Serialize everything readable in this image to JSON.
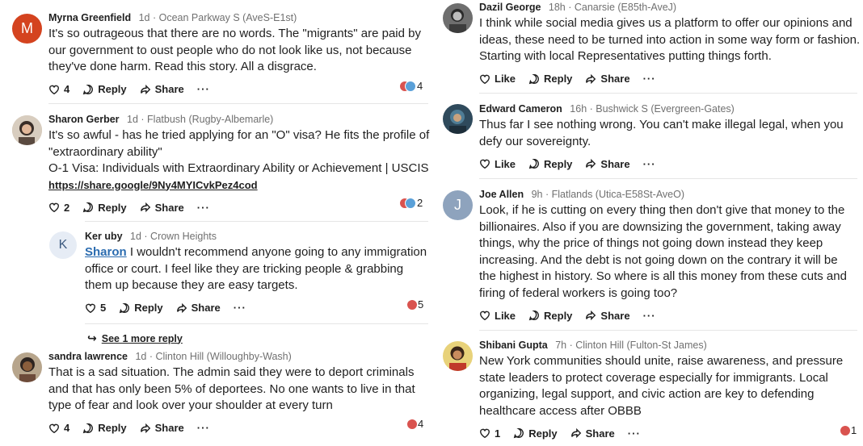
{
  "comments": [
    {
      "author": "Myrna Greenfield",
      "meta": "1d · Ocean Parkway S (AveS-E1st)",
      "avatar_letter": "M",
      "avatar_color": "#d4431f",
      "lines": [
        "It's so outrageous that there are no words. The \"migrants\" are paid by",
        "our government to oust people who do not look like us, not because",
        "they've done harm. Read this story. All a disgrace."
      ],
      "like_count": "4",
      "reply_label": "Reply",
      "share_label": "Share",
      "more": "···",
      "reaction_count": "4"
    },
    {
      "author": "Sharon Gerber",
      "meta": "1d · Flatbush (Rugby-Albemarle)",
      "lines": [
        "It's so awful - has he tried applying for an \"O\" visa?  He fits the profile of",
        "\"extraordinary ability\"",
        "O-1 Visa: Individuals with Extraordinary Ability or Achievement | USCIS"
      ],
      "link": "https://share.google/9Ny4MYICvkPez4cod",
      "like_count": "2",
      "reply_label": "Reply",
      "share_label": "Share",
      "more": "···",
      "reaction_count": "2"
    },
    {
      "author": "Ker uby",
      "meta": "1d · Crown Heights",
      "avatar_letter": "K",
      "avatar_color": "#e6ecf5",
      "mention": "Sharon",
      "first_line_rest": " I wouldn't recommend anyone going to any immigration",
      "lines": [
        "office or court. I feel like they are tricking people & grabbing",
        "them up because they are easy targets."
      ],
      "like_count": "5",
      "reply_label": "Reply",
      "share_label": "Share",
      "more": "···",
      "reaction_count": "5"
    },
    {
      "author": "sandra lawrence",
      "meta": "1d · Clinton Hill (Willoughby-Wash)",
      "lines": [
        "That is a sad situation. The admin said they were to deport criminals",
        "and that has only been 5% of deportees.  No one wants to live in that",
        "type of fear and look over your shoulder at every turn"
      ],
      "like_count": "4",
      "reply_label": "Reply",
      "share_label": "Share",
      "more": "···",
      "reaction_count": "4"
    },
    {
      "author": "Dazil George",
      "meta": "18h · Canarsie (E85th-AveJ)",
      "lines": [
        "I think while social media gives us a platform to offer our opinions and",
        "ideas, these need to be turned into action in some way form or fashion.",
        "Starting with local Representatives putting things forth."
      ],
      "like_label": "Like",
      "reply_label": "Reply",
      "share_label": "Share",
      "more": "···"
    },
    {
      "author": "Edward Cameron",
      "meta": "16h · Bushwick S (Evergreen-Gates)",
      "lines": [
        "Thus far I see nothing wrong.  You can't make illegal legal, when you",
        "defy our sovereignty."
      ],
      "like_label": "Like",
      "reply_label": "Reply",
      "share_label": "Share",
      "more": "···"
    },
    {
      "author": "Joe Allen",
      "meta": "9h · Flatlands (Utica-E58St-AveO)",
      "avatar_letter": "J",
      "avatar_color": "#8ea3bd",
      "lines": [
        "Look, if he is cutting on every thing then don't give that money to the",
        "billionaires. Also if you are downsizing the government, taking away",
        "things, why the price of things not going down instead they keep",
        "increasing. And the debt is not going down on the contrary it will be",
        "the highest in history. So where is all this money from these cuts and",
        "firing of federal workers is going too?"
      ],
      "like_label": "Like",
      "reply_label": "Reply",
      "share_label": "Share",
      "more": "···"
    },
    {
      "author": "Shibani Gupta",
      "meta": "7h · Clinton Hill (Fulton-St James)",
      "lines": [
        "New York communities should unite, raise awareness, and pressure",
        "state leaders to protect coverage especially for immigrants. Local",
        "organizing, legal support, and civic action are key to defending",
        "healthcare access after OBBB"
      ],
      "like_count": "1",
      "reply_label": "Reply",
      "share_label": "Share",
      "more": "···",
      "reaction_count": "1"
    }
  ],
  "see_more": {
    "arrow": "↪",
    "label": "See 1 more reply"
  },
  "colors": {
    "like_face": "#d9534f",
    "sad_face": "#5aa0d8",
    "divider": "#e5e5e5"
  }
}
